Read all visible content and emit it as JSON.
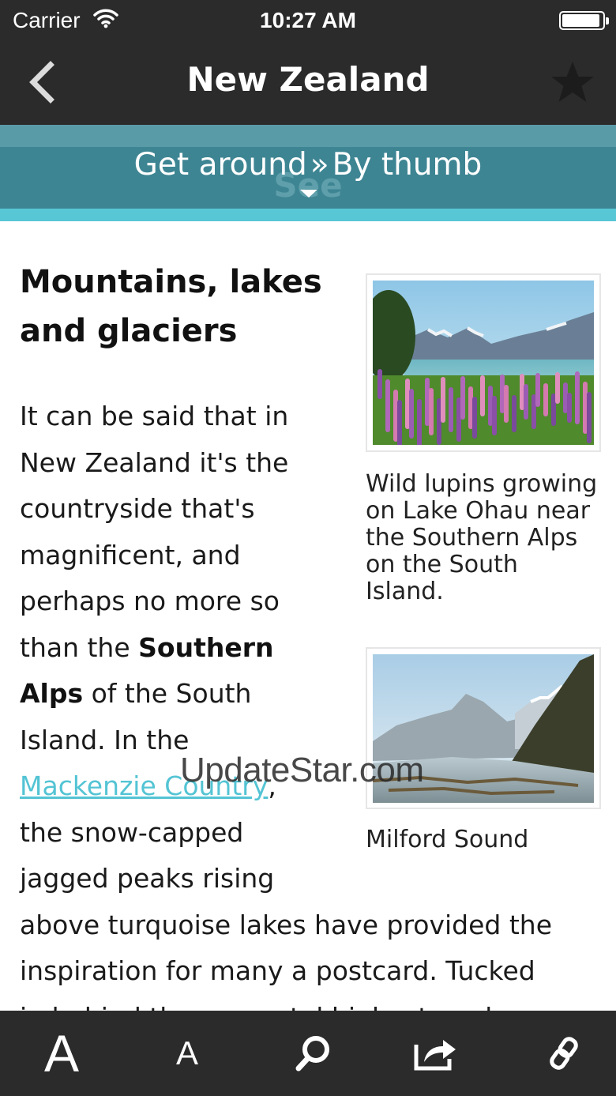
{
  "status": {
    "carrier": "Carrier",
    "time": "10:27 AM",
    "battery_level": 0.95
  },
  "nav": {
    "title": "New Zealand",
    "back_icon": "chevron-left-icon",
    "favorite_icon": "star-icon"
  },
  "section": {
    "ghost_title": "See",
    "crumb_parent": "Get around",
    "crumb_separator": "»",
    "crumb_child": "By thumb"
  },
  "article": {
    "heading": "Mountains, lakes and glaciers",
    "lines": [
      {
        "parts": [
          {
            "text": "It can be said that in"
          }
        ]
      },
      {
        "parts": [
          {
            "text": "New Zealand it's the"
          }
        ]
      },
      {
        "parts": [
          {
            "text": "countryside that's"
          }
        ]
      },
      {
        "parts": [
          {
            "text": "magnificent, and"
          }
        ]
      },
      {
        "parts": [
          {
            "text": "perhaps no more so"
          }
        ]
      },
      {
        "parts": [
          {
            "text": "than the "
          },
          {
            "text": "Southern",
            "bold": true
          }
        ]
      },
      {
        "parts": [
          {
            "text": "Alps",
            "bold": true
          },
          {
            "text": " of the South"
          }
        ]
      },
      {
        "parts": [
          {
            "text": "Island. In the"
          }
        ]
      },
      {
        "parts": [
          {
            "text": "Mackenzie Country",
            "link": true
          },
          {
            "text": ","
          }
        ]
      },
      {
        "parts": [
          {
            "text": "the snow-capped"
          }
        ]
      },
      {
        "parts": [
          {
            "text": "jagged peaks rising"
          }
        ]
      },
      {
        "parts": [
          {
            "text": "above turquoise lakes have provided the"
          }
        ]
      },
      {
        "parts": [
          {
            "text": "inspiration for many a postcard. Tucked"
          }
        ]
      },
      {
        "parts": [
          {
            "text": "in behind these coastal highest peaks"
          }
        ]
      }
    ],
    "figures": [
      {
        "caption": "Wild lupins growing on Lake Ohau near the Southern Alps on the South Island."
      },
      {
        "caption": "Milford Sound"
      }
    ]
  },
  "watermark": "UpdateStar.com",
  "toolbar": {
    "increase_font_label": "A",
    "decrease_font_label": "A",
    "search_icon": "search-icon",
    "share_icon": "share-icon",
    "link_icon": "link-icon"
  },
  "colors": {
    "bar_dark": "#2b2b2b",
    "section_teal": "#3e8593",
    "accent_cyan": "#58c7d5",
    "link": "#53c4d4"
  }
}
